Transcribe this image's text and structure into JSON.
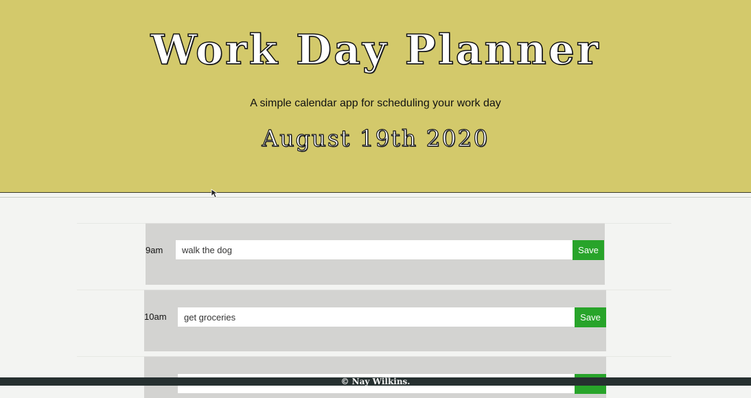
{
  "header": {
    "title": "Work Day Planner",
    "subtitle": "A simple calendar app for scheduling your work day",
    "date": "August 19th 2020",
    "background_color": "#d3c96b"
  },
  "schedule": {
    "rows": [
      {
        "hour": "9am",
        "task": "walk the dog",
        "save_label": "Save"
      },
      {
        "hour": "10am",
        "task": "get groceries",
        "save_label": "Save"
      },
      {
        "hour": "",
        "task": "",
        "save_label": ""
      }
    ],
    "block_color": "#d3d3d1",
    "save_color": "#28a42a"
  },
  "footer": {
    "text": "© Nay Wilkins."
  }
}
